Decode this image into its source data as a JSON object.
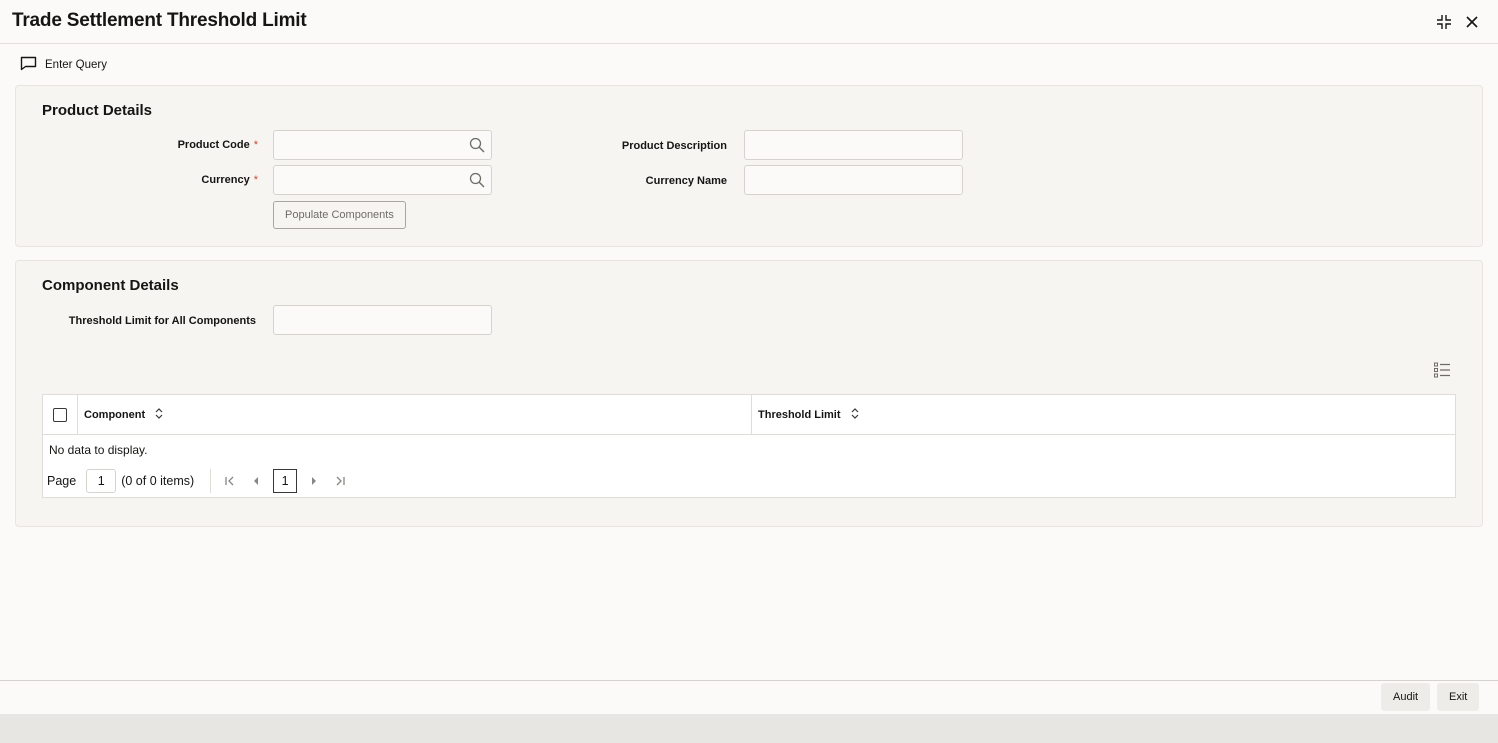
{
  "window": {
    "title": "Trade Settlement Threshold Limit"
  },
  "toolbar": {
    "enter_query_label": "Enter Query"
  },
  "product_details": {
    "section_title": "Product Details",
    "product_code_label": "Product Code",
    "product_code_value": "",
    "currency_label": "Currency",
    "currency_value": "",
    "required_marker": "*",
    "populate_button_label": "Populate Components",
    "product_description_label": "Product Description",
    "product_description_value": "",
    "currency_name_label": "Currency Name",
    "currency_name_value": ""
  },
  "component_details": {
    "section_title": "Component Details",
    "threshold_all_label": "Threshold Limit for All Components",
    "threshold_all_value": "",
    "table": {
      "columns": [
        "Component",
        "Threshold Limit"
      ],
      "rows": [],
      "empty_text": "No data to display.",
      "pager": {
        "page_label": "Page",
        "page_value": "1",
        "items_text": "(0 of 0 items)",
        "current_page": "1"
      }
    }
  },
  "footer": {
    "audit_label": "Audit",
    "exit_label": "Exit"
  },
  "colors": {
    "required": "#c74634",
    "panel_bg": "#f7f5f2",
    "page_bg": "#fbfaf8"
  },
  "icons": [
    "chat-bubble-icon",
    "search-icon",
    "collapse-icon",
    "close-icon",
    "column-list-icon",
    "sort-icon",
    "first-page-icon",
    "prev-page-icon",
    "next-page-icon",
    "last-page-icon"
  ]
}
